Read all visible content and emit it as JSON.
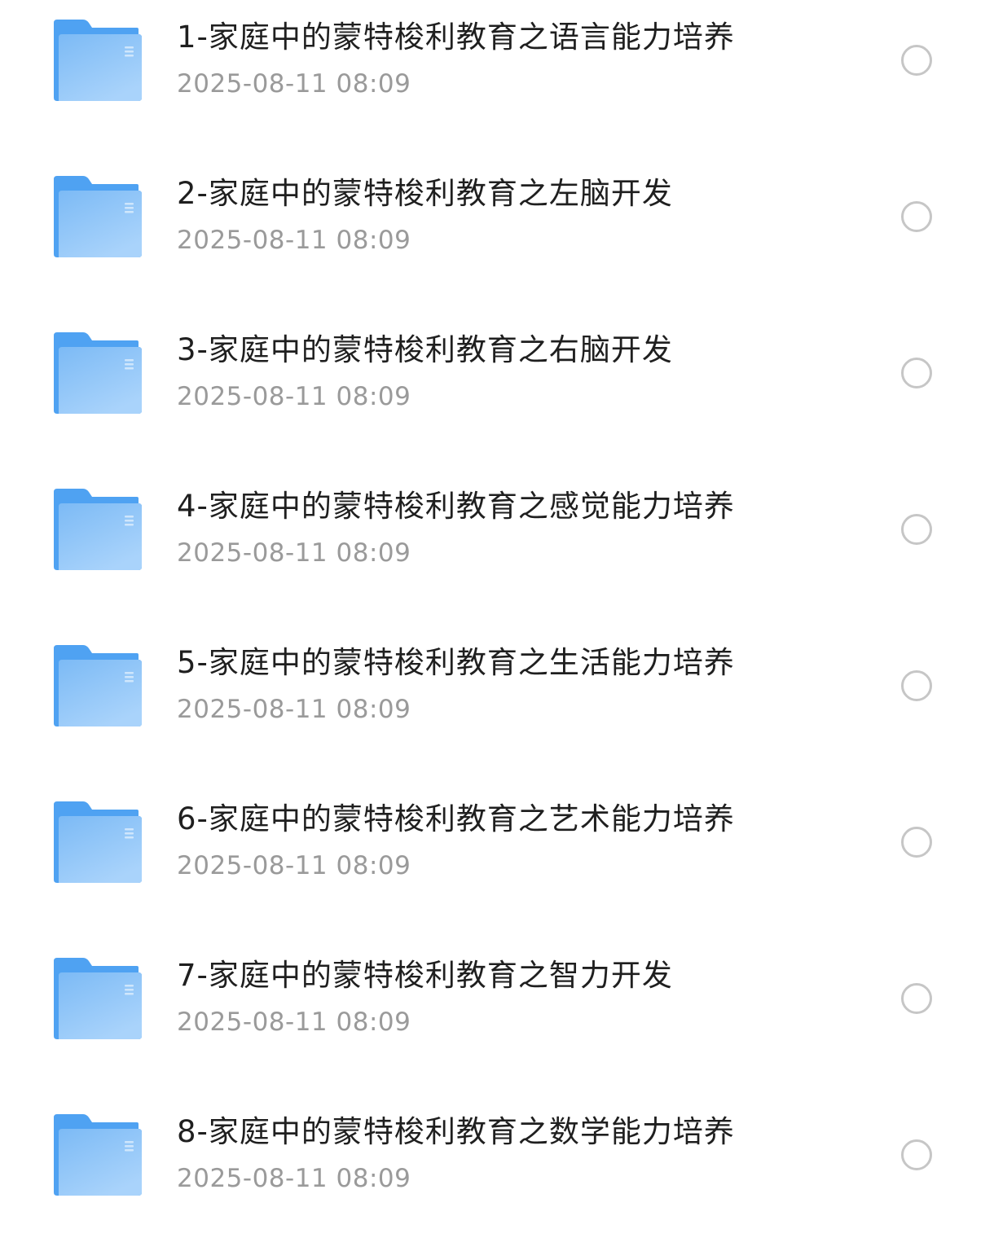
{
  "colors": {
    "folder_tab": "#4fa2f2",
    "folder_body_top": "#7cbaf5",
    "folder_body_bottom": "#a9d3fb",
    "title_text": "#1f1f1f",
    "date_text": "#9a9a9a",
    "radio_border": "#c6c6c6"
  },
  "files": [
    {
      "icon": "folder-icon",
      "name": "1-家庭中的蒙特梭利教育之语言能力培养",
      "date": "2025-08-11 08:09",
      "selected": false
    },
    {
      "icon": "folder-icon",
      "name": "2-家庭中的蒙特梭利教育之左脑开发",
      "date": "2025-08-11 08:09",
      "selected": false
    },
    {
      "icon": "folder-icon",
      "name": "3-家庭中的蒙特梭利教育之右脑开发",
      "date": "2025-08-11 08:09",
      "selected": false
    },
    {
      "icon": "folder-icon",
      "name": "4-家庭中的蒙特梭利教育之感觉能力培养",
      "date": "2025-08-11 08:09",
      "selected": false
    },
    {
      "icon": "folder-icon",
      "name": "5-家庭中的蒙特梭利教育之生活能力培养",
      "date": "2025-08-11 08:09",
      "selected": false
    },
    {
      "icon": "folder-icon",
      "name": "6-家庭中的蒙特梭利教育之艺术能力培养",
      "date": "2025-08-11 08:09",
      "selected": false
    },
    {
      "icon": "folder-icon",
      "name": "7-家庭中的蒙特梭利教育之智力开发",
      "date": "2025-08-11 08:09",
      "selected": false
    },
    {
      "icon": "folder-icon",
      "name": "8-家庭中的蒙特梭利教育之数学能力培养",
      "date": "2025-08-11 08:09",
      "selected": false
    }
  ]
}
